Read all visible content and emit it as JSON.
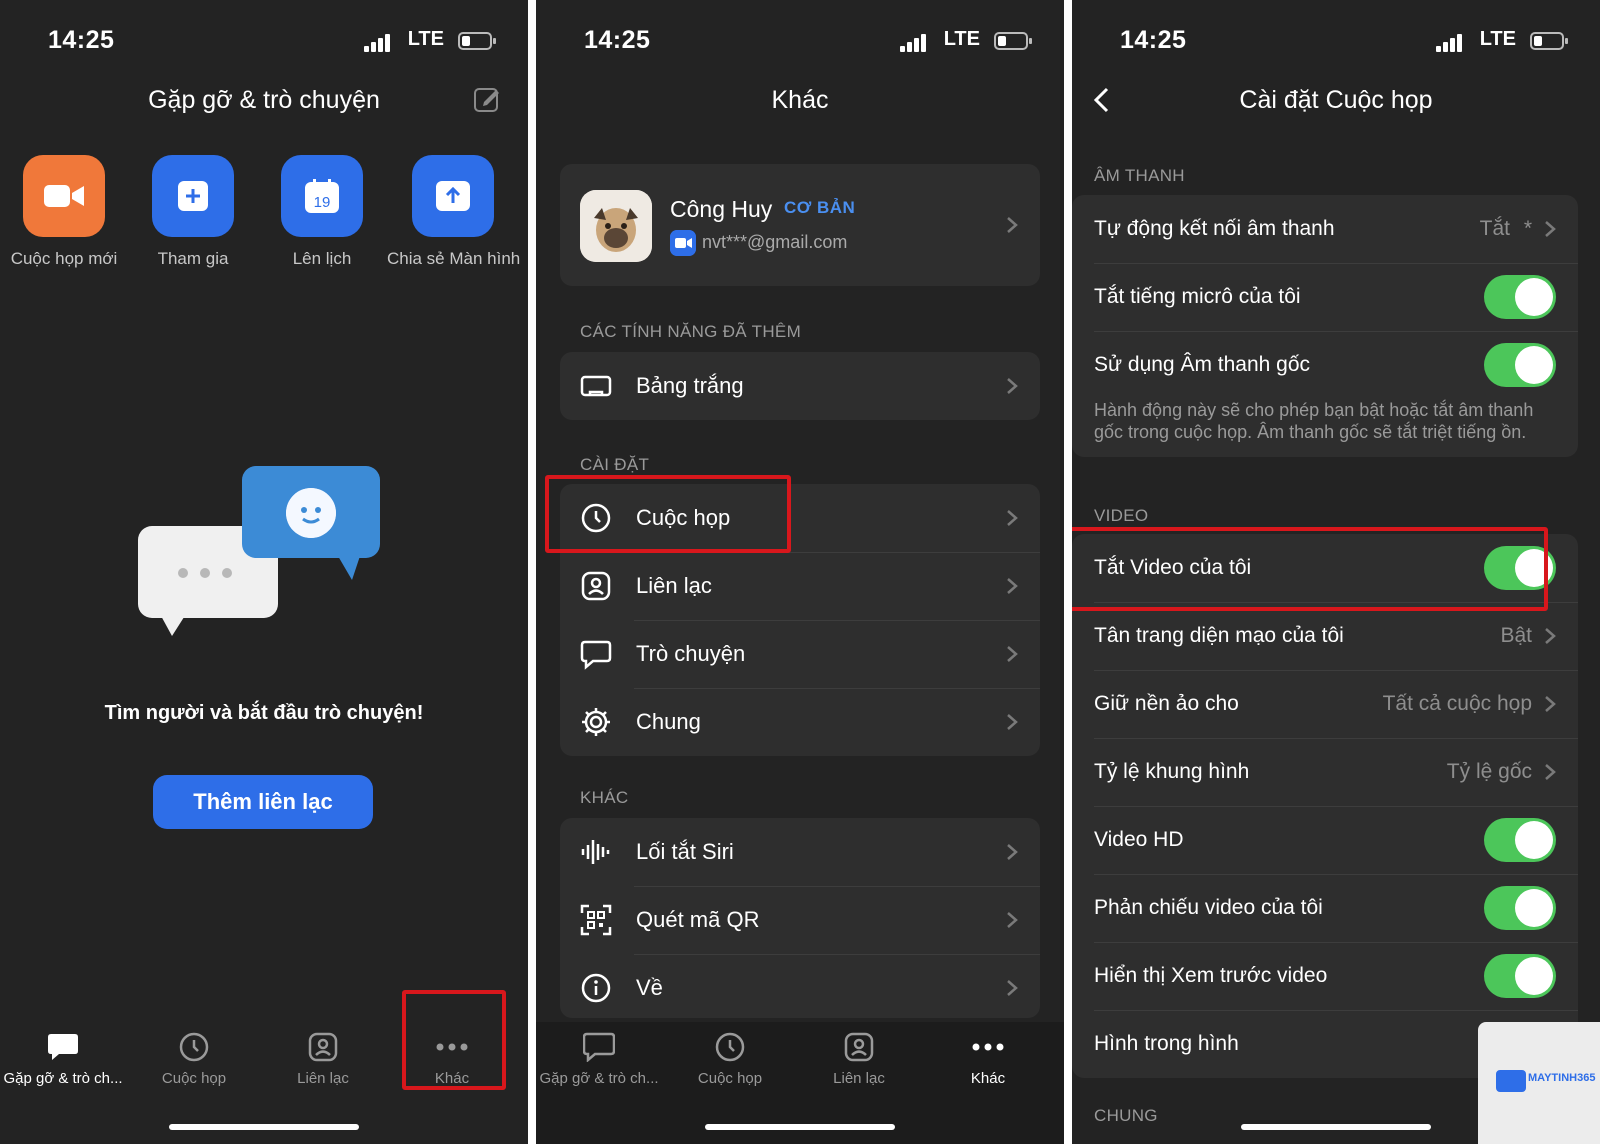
{
  "status": {
    "time": "14:25",
    "network": "LTE"
  },
  "screen1": {
    "title": "Gặp gỡ & trò chuyện",
    "actions": [
      {
        "label": "Cuộc họp mới",
        "icon": "video-camera-icon"
      },
      {
        "label": "Tham gia",
        "icon": "plus-icon"
      },
      {
        "label": "Lên lịch",
        "icon": "calendar-icon",
        "calendar_day": "19"
      },
      {
        "label": "Chia sẻ Màn hình",
        "icon": "share-screen-icon"
      }
    ],
    "empty_text": "Tìm người và bắt đầu trò chuyện!",
    "add_button": "Thêm liên lạc",
    "tabs": [
      {
        "label": "Gặp gỡ & trò ch...",
        "icon": "chat-icon",
        "active": true
      },
      {
        "label": "Cuộc họp",
        "icon": "clock-icon",
        "active": false
      },
      {
        "label": "Liên lạc",
        "icon": "contact-icon",
        "active": false
      },
      {
        "label": "Khác",
        "icon": "more-icon",
        "active": false
      }
    ]
  },
  "screen2": {
    "title": "Khác",
    "profile": {
      "name": "Công Huy",
      "badge": "CƠ BẢN",
      "email": "nvt***@gmail.com"
    },
    "sections": [
      {
        "header": "CÁC TÍNH NĂNG ĐÃ THÊM",
        "items": [
          {
            "label": "Bảng trắng",
            "icon": "whiteboard-icon"
          }
        ]
      },
      {
        "header": "CÀI ĐẶT",
        "items": [
          {
            "label": "Cuộc họp",
            "icon": "clock-icon"
          },
          {
            "label": "Liên lạc",
            "icon": "contact-icon"
          },
          {
            "label": "Trò chuyện",
            "icon": "chat-bubble-icon"
          },
          {
            "label": "Chung",
            "icon": "gear-icon"
          }
        ]
      },
      {
        "header": "KHÁC",
        "items": [
          {
            "label": "Lối tắt Siri",
            "icon": "siri-waveform-icon"
          },
          {
            "label": "Quét mã QR",
            "icon": "qr-code-icon"
          },
          {
            "label": "Về",
            "icon": "info-icon"
          }
        ]
      }
    ],
    "tabs": [
      {
        "label": "Gặp gỡ & trò ch...",
        "icon": "chat-icon",
        "active": false
      },
      {
        "label": "Cuộc họp",
        "icon": "clock-icon",
        "active": false
      },
      {
        "label": "Liên lạc",
        "icon": "contact-icon",
        "active": false
      },
      {
        "label": "Khác",
        "icon": "more-icon",
        "active": true
      }
    ]
  },
  "screen3": {
    "title": "Cài đặt Cuộc họp",
    "audio": {
      "header": "ÂM THANH",
      "auto_connect": {
        "label": "Tự động kết nối âm thanh",
        "value": "Tắt",
        "marker": "*"
      },
      "mute_mic": {
        "label": "Tắt tiếng micrô của tôi",
        "on": true
      },
      "original_sound": {
        "label": "Sử dụng Âm thanh gốc",
        "on": true
      },
      "original_sound_desc": "Hành động này sẽ cho phép bạn bật hoặc tắt âm thanh gốc trong cuộc họp. Âm thanh gốc sẽ tắt triệt tiếng ồn."
    },
    "video": {
      "header": "VIDEO",
      "rows": [
        {
          "label": "Tắt Video của tôi",
          "type": "toggle",
          "on": true
        },
        {
          "label": "Tân trang diện mạo của tôi",
          "type": "value",
          "value": "Bật"
        },
        {
          "label": "Giữ nền ảo cho",
          "type": "value",
          "value": "Tất cả cuộc họp"
        },
        {
          "label": "Tỷ lệ khung hình",
          "type": "value",
          "value": "Tỷ lệ gốc"
        },
        {
          "label": "Video HD",
          "type": "toggle",
          "on": true
        },
        {
          "label": "Phản chiếu video của tôi",
          "type": "toggle",
          "on": true
        },
        {
          "label": "Hiển thị Xem trước video",
          "type": "toggle",
          "on": true
        },
        {
          "label": "Hình trong hình",
          "type": "toggle",
          "on": true
        }
      ]
    },
    "next_header": "CHUNG"
  },
  "watermark": "MAYTINH365",
  "colors": {
    "background": "#232323",
    "card": "#2e2e2e",
    "accent_blue": "#2e6ee8",
    "accent_orange": "#f0783a",
    "toggle_on": "#4cc65a",
    "highlight_red": "#d8171c"
  }
}
